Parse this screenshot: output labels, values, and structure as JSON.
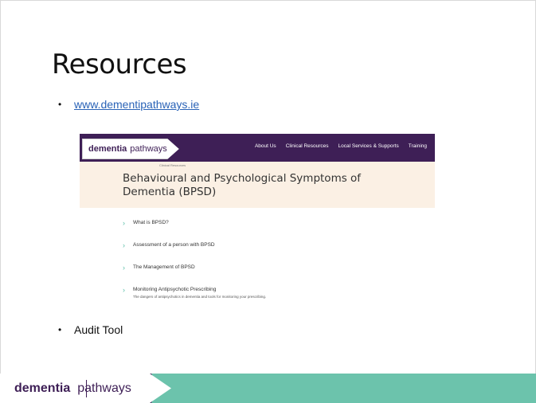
{
  "slide": {
    "title": "Resources",
    "bullets": [
      {
        "text": "www.dementipathways.ie",
        "is_link": true
      },
      {
        "text": "Audit Tool",
        "is_link": false
      }
    ]
  },
  "website": {
    "logo": {
      "word1": "dementia",
      "word2": "pathways"
    },
    "nav": [
      "About Us",
      "Clinical Resources",
      "Local Services & Supports",
      "Training"
    ],
    "breadcrumb": "Clinical Resources",
    "heading": "Behavioural and Psychological Symptoms of Dementia (BPSD)",
    "items": [
      {
        "label": "What is BPSD?",
        "description": ""
      },
      {
        "label": "Assessment of a person with BPSD",
        "description": ""
      },
      {
        "label": "The Management of BPSD",
        "description": ""
      },
      {
        "label": "Monitoring Antipsychotic Prescribing",
        "description": "The dangers of antipsychotics in dementia and tools for monitoring your prescribing."
      }
    ]
  },
  "footer": {
    "logo_word1": "dementia",
    "logo_word2": "pathways"
  },
  "colors": {
    "brand_purple": "#3e1f56",
    "brand_teal": "#6cc3ac",
    "link_blue": "#2a63b7",
    "band_cream": "#fbf0e4"
  }
}
